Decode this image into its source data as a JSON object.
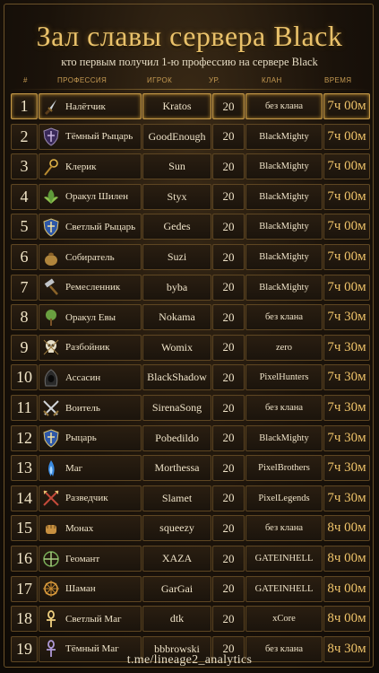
{
  "header": {
    "title": "Зал славы сервера Black",
    "subtitle": "кто первым получил 1-ю профессию на сервере Black"
  },
  "columns": {
    "rank": "#",
    "profession": "ПРОФЕССИЯ",
    "player": "ИГРОК",
    "level": "УР.",
    "clan": "КЛАН",
    "time": "ВРЕМЯ"
  },
  "rows": [
    {
      "rank": "1",
      "profession": "Налётчик",
      "icon": "dagger-icon",
      "player": "Kratos",
      "level": "20",
      "clan": "без клана",
      "time": "7ч 00м"
    },
    {
      "rank": "2",
      "profession": "Тёмный Рыцарь",
      "icon": "dark-shield-icon",
      "player": "GoodEnough",
      "level": "20",
      "clan": "BlackMighty",
      "time": "7ч 00м"
    },
    {
      "rank": "3",
      "profession": "Клерик",
      "icon": "staff-icon",
      "player": "Sun",
      "level": "20",
      "clan": "BlackMighty",
      "time": "7ч 00м"
    },
    {
      "rank": "4",
      "profession": "Оракул Шилен",
      "icon": "leaf-icon",
      "player": "Styx",
      "level": "20",
      "clan": "BlackMighty",
      "time": "7ч 00м"
    },
    {
      "rank": "5",
      "profession": "Светлый Рыцарь",
      "icon": "blue-shield-icon",
      "player": "Gedes",
      "level": "20",
      "clan": "BlackMighty",
      "time": "7ч 00м"
    },
    {
      "rank": "6",
      "profession": "Собиратель",
      "icon": "bag-icon",
      "player": "Suzi",
      "level": "20",
      "clan": "BlackMighty",
      "time": "7ч 00м"
    },
    {
      "rank": "7",
      "profession": "Ремесленник",
      "icon": "hammer-icon",
      "player": "byba",
      "level": "20",
      "clan": "BlackMighty",
      "time": "7ч 00м"
    },
    {
      "rank": "8",
      "profession": "Оракул Евы",
      "icon": "tree-icon",
      "player": "Nokama",
      "level": "20",
      "clan": "без клана",
      "time": "7ч 30м"
    },
    {
      "rank": "9",
      "profession": "Разбойник",
      "icon": "skull-icon",
      "player": "Womix",
      "level": "20",
      "clan": "zero",
      "time": "7ч 30м"
    },
    {
      "rank": "10",
      "profession": "Ассасин",
      "icon": "hood-icon",
      "player": "BlackShadow",
      "level": "20",
      "clan": "PixelHunters",
      "time": "7ч 30м"
    },
    {
      "rank": "11",
      "profession": "Воитель",
      "icon": "crossed-swords-icon",
      "player": "SirenaSong",
      "level": "20",
      "clan": "без клана",
      "time": "7ч 30м"
    },
    {
      "rank": "12",
      "profession": "Рыцарь",
      "icon": "blue-shield-icon",
      "player": "Pobedildo",
      "level": "20",
      "clan": "BlackMighty",
      "time": "7ч 30м"
    },
    {
      "rank": "13",
      "profession": "Маг",
      "icon": "blue-flame-icon",
      "player": "Morthessa",
      "level": "20",
      "clan": "PixelBrothers",
      "time": "7ч 30м"
    },
    {
      "rank": "14",
      "profession": "Разведчик",
      "icon": "crossed-arrows-icon",
      "player": "Slamet",
      "level": "20",
      "clan": "PixelLegends",
      "time": "7ч 30м"
    },
    {
      "rank": "15",
      "profession": "Монах",
      "icon": "fist-icon",
      "player": "squeezy",
      "level": "20",
      "clan": "без клана",
      "time": "8ч 00м"
    },
    {
      "rank": "16",
      "profession": "Геомант",
      "icon": "rune-icon",
      "player": "XAZA",
      "level": "20",
      "clan": "GATEINHELL",
      "time": "8ч 00м"
    },
    {
      "rank": "17",
      "profession": "Шаман",
      "icon": "wheel-icon",
      "player": "GarGai",
      "level": "20",
      "clan": "GATEINHELL",
      "time": "8ч 00м"
    },
    {
      "rank": "18",
      "profession": "Светлый Маг",
      "icon": "ankh-icon",
      "player": "dtk",
      "level": "20",
      "clan": "xCore",
      "time": "8ч 00м"
    },
    {
      "rank": "19",
      "profession": "Тёмный Маг",
      "icon": "dark-ankh-icon",
      "player": "bbbrowski",
      "level": "20",
      "clan": "без клана",
      "time": "8ч 30м"
    }
  ],
  "footer": "t.me/lineage2_analytics"
}
